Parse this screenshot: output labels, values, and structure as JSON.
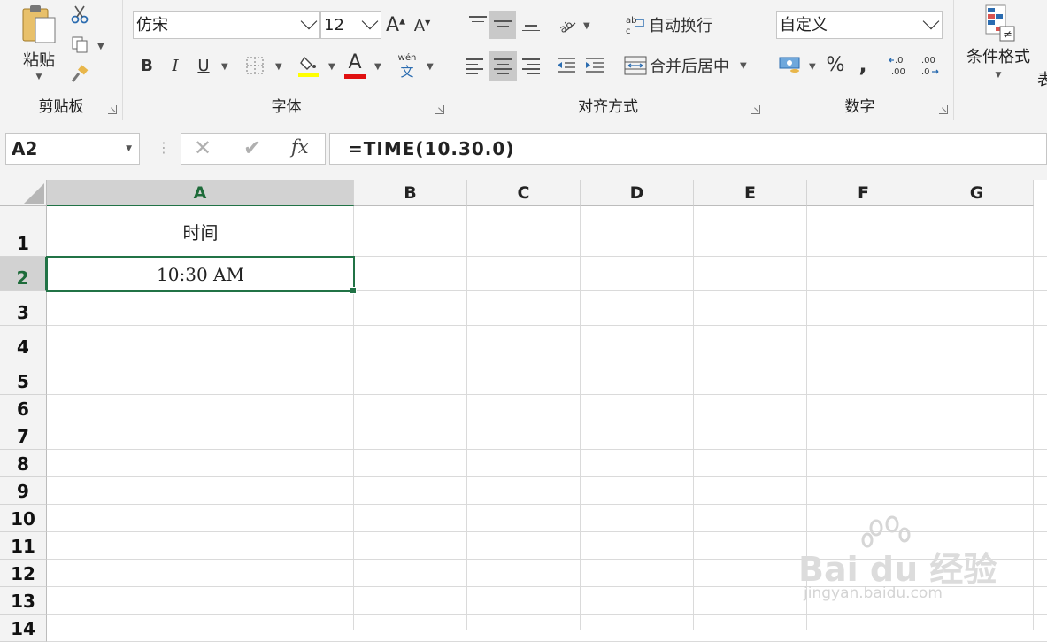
{
  "ribbon": {
    "clipboard": {
      "paste_label": "粘贴",
      "group_label": "剪贴板"
    },
    "font": {
      "font_name": "仿宋",
      "font_size": "12",
      "bold": "B",
      "italic": "I",
      "underline": "U",
      "font_color_glyph": "A",
      "phonetic_top": "wén",
      "phonetic_bottom": "文",
      "group_label": "字体",
      "highlight_color": "#ffff00",
      "font_color": "#e01010"
    },
    "alignment": {
      "wrap_text_label": "自动换行",
      "merge_center_label": "合并后居中",
      "group_label": "对齐方式"
    },
    "number": {
      "format_value": "自定义",
      "percent": "%",
      "comma": ",",
      "group_label": "数字"
    },
    "styles": {
      "conditional_format_label": "条件格式",
      "next_partial_label": "表"
    }
  },
  "formula_bar": {
    "name_box": "A2",
    "fx": "fx",
    "formula": "=TIME(10.30.0)"
  },
  "sheet": {
    "columns": [
      "A",
      "B",
      "C",
      "D",
      "E",
      "F",
      "G"
    ],
    "rows": [
      "1",
      "2",
      "3",
      "4",
      "5",
      "6",
      "7",
      "8",
      "9",
      "10",
      "11",
      "12",
      "13",
      "14"
    ],
    "selected_cell": "A2",
    "cells": {
      "A1": "时间",
      "A2": "10:30 AM"
    },
    "accent_color": "#217346"
  },
  "watermark": {
    "brand": "Bai du 经验",
    "url": "jingyan.baidu.com"
  }
}
